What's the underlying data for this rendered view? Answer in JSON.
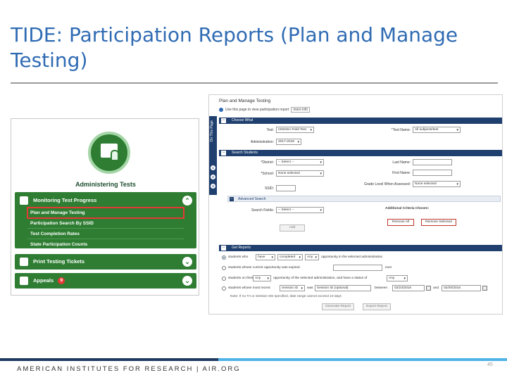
{
  "slide": {
    "title": "TIDE: Participation Reports (Plan and Manage Testing)",
    "footer": "AMERICAN INSTITUTES FOR RESEARCH | AIR.ORG",
    "page_number": "45"
  },
  "colors": {
    "title_blue": "#2f6bb3",
    "menu_green": "#2e7d32",
    "tide_navy": "#1f3f6e",
    "highlight_red": "#e53935",
    "footer_dark": "#1f3a5f",
    "footer_light": "#4fb3e8"
  },
  "left_menu": {
    "tile_label": "Administering Tests",
    "tile_icon": "presenter-board-icon",
    "sections": [
      {
        "label": "Monitoring Test Progress",
        "icon": "car-icon",
        "expanded": true,
        "items": [
          {
            "label": "Plan and Manage Testing",
            "highlighted": true
          },
          {
            "label": "Participation Search By SSID"
          },
          {
            "label": "Test Completion Rates"
          },
          {
            "label": "State Participation Counts"
          }
        ]
      },
      {
        "label": "Print Testing Tickets",
        "icon": "printer-icon"
      },
      {
        "label": "Appeals",
        "icon": "gear-icon",
        "badge": "9"
      }
    ]
  },
  "tide": {
    "title": "Plan and Manage Testing",
    "info_text": "Use this page to view participation report",
    "info_select": "more info",
    "side_tab_text": "On This Page",
    "side_steps": [
      "1",
      "2",
      "3"
    ],
    "choose_what": {
      "header": "Choose What",
      "test_label": "Test:",
      "test_value": "ISNGDA Field Test",
      "test_name_label": "*Test Name:",
      "test_name_value": "All subjects/test",
      "admin_label": "Administration:",
      "admin_value": "2017-2018"
    },
    "search_students": {
      "header": "Search Students",
      "district_label": "*District:",
      "district_value": "-- Select --",
      "school_label": "*School:",
      "school_value": "None selected",
      "ssid_label": "SSID:",
      "last_name_label": "Last Name:",
      "first_name_label": "First Name:",
      "grade_label": "Grade Level When Assessed:",
      "grade_value": "None selected"
    },
    "advanced": {
      "header": "Advanced Search",
      "fields_label": "Search Fields:",
      "fields_value": "-- Select --",
      "criteria_label": "Additional Criteria Chosen:",
      "add_label": "Add",
      "remove_all": "Remove All",
      "remove_selected": "Remove Selected"
    },
    "get_reports": {
      "header": "Get Reports",
      "row1": {
        "a": "students who",
        "sel1": "have",
        "sel2": "completed",
        "sel3": "Any",
        "b": "opportunity in the selected administration"
      },
      "row2": {
        "a": "students whose current opportunity was expired",
        "b": "ever"
      },
      "row3": {
        "a": "students on their",
        "sel1": "Any",
        "b": "opportunity of the selected administration, and have a status of",
        "sel2": "Any"
      },
      "row4": {
        "a": "students whose most recent",
        "sel1": "Session ID",
        "b": "was",
        "sel2": "Session ID (optional)",
        "c": "between",
        "d1": "02/23/2016",
        "d_and": "and",
        "d2": "02/30/2016"
      },
      "note": "Note: If no TA or Session IDs specified, date range cannot exceed 10 days",
      "generate": "Generate Report",
      "export": "Export Report"
    }
  }
}
